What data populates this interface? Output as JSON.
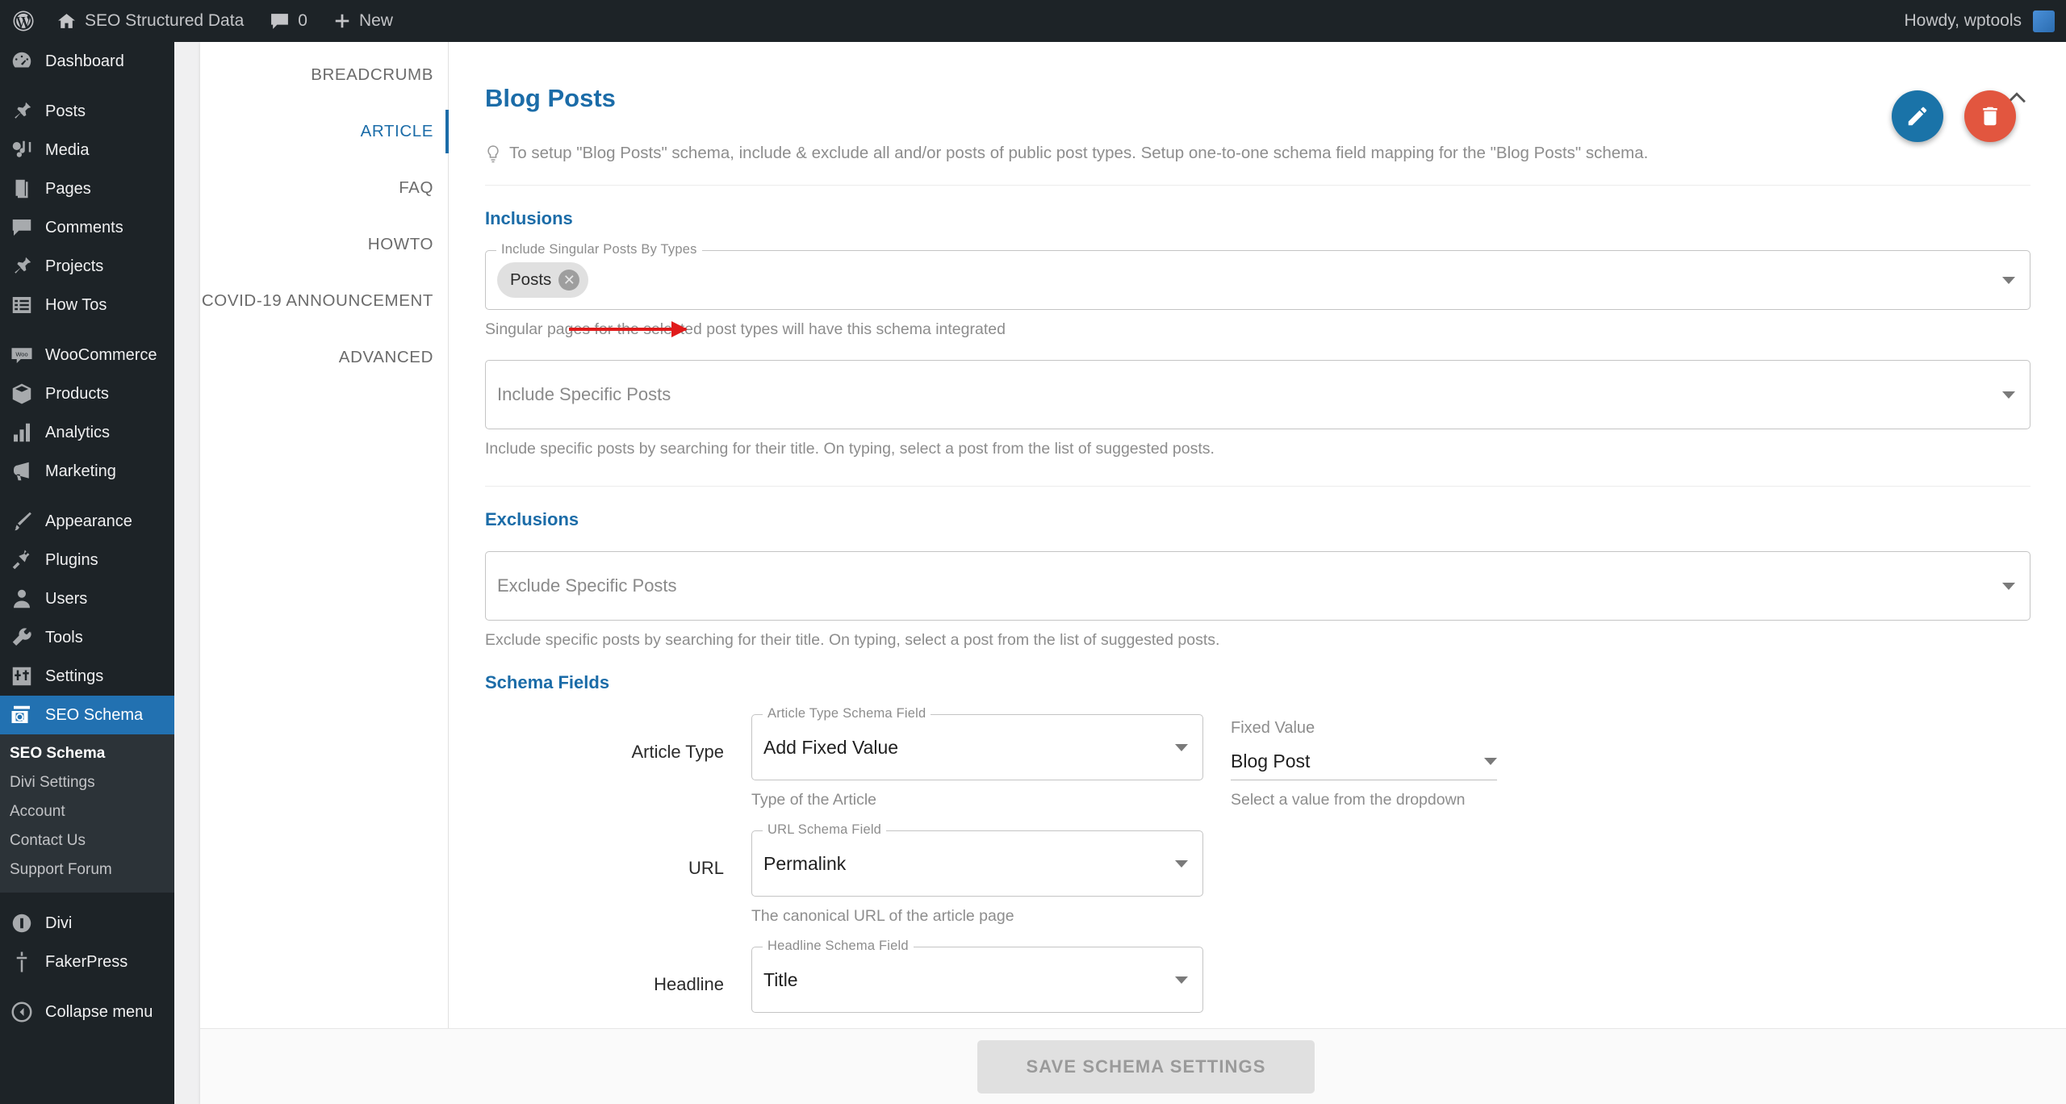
{
  "adminbar": {
    "site_title": "SEO Structured Data",
    "comment_count": "0",
    "new_label": "New",
    "howdy": "Howdy, wptools"
  },
  "sidebar": {
    "items": [
      {
        "label": "Dashboard",
        "icon": "dashboard-icon"
      },
      {
        "label": "Posts",
        "icon": "pin-icon"
      },
      {
        "label": "Media",
        "icon": "media-icon"
      },
      {
        "label": "Pages",
        "icon": "pages-icon"
      },
      {
        "label": "Comments",
        "icon": "comment-icon"
      },
      {
        "label": "Projects",
        "icon": "pin-icon"
      },
      {
        "label": "How Tos",
        "icon": "list-icon"
      },
      {
        "label": "WooCommerce",
        "icon": "woo-icon"
      },
      {
        "label": "Products",
        "icon": "box-icon"
      },
      {
        "label": "Analytics",
        "icon": "bars-icon"
      },
      {
        "label": "Marketing",
        "icon": "megaphone-icon"
      },
      {
        "label": "Appearance",
        "icon": "brush-icon"
      },
      {
        "label": "Plugins",
        "icon": "plug-icon"
      },
      {
        "label": "Users",
        "icon": "user-icon"
      },
      {
        "label": "Tools",
        "icon": "wrench-icon"
      },
      {
        "label": "Settings",
        "icon": "sliders-icon"
      },
      {
        "label": "SEO Schema",
        "icon": "schema-icon"
      },
      {
        "label": "Divi",
        "icon": "divi-icon"
      },
      {
        "label": "FakerPress",
        "icon": "faker-icon"
      },
      {
        "label": "Collapse menu",
        "icon": "collapse-icon"
      }
    ],
    "submenu": [
      "SEO Schema",
      "Divi Settings",
      "Account",
      "Contact Us",
      "Support Forum"
    ]
  },
  "tabs": [
    "BREADCRUMB",
    "ARTICLE",
    "FAQ",
    "HOWTO",
    "COVID-19 ANNOUNCEMENT",
    "ADVANCED"
  ],
  "active_tab": "ARTICLE",
  "card": {
    "title": "Blog Posts",
    "description": "To setup \"Blog Posts\" schema, include & exclude all and/or posts of public post types. Setup one-to-one schema field mapping for the \"Blog Posts\" schema."
  },
  "inclusions": {
    "heading": "Inclusions",
    "post_types_legend": "Include Singular Posts By Types",
    "post_types_chip": "Posts",
    "post_types_helper": "Singular pages for the selected post types will have this schema integrated",
    "specific_placeholder": "Include Specific Posts",
    "specific_helper": "Include specific posts by searching for their title. On typing, select a post from the list of suggested posts."
  },
  "exclusions": {
    "heading": "Exclusions",
    "specific_placeholder": "Exclude Specific Posts",
    "specific_helper": "Exclude specific posts by searching for their title. On typing, select a post from the list of suggested posts."
  },
  "schema_fields": {
    "heading": "Schema Fields",
    "rows": [
      {
        "label": "Article Type",
        "legend": "Article Type Schema Field",
        "value": "Add Fixed Value",
        "helper": "Type of the Article",
        "side_label": "Fixed Value",
        "side_value": "Blog Post",
        "side_helper": "Select a value from the dropdown"
      },
      {
        "label": "URL",
        "legend": "URL Schema Field",
        "value": "Permalink",
        "helper": "The canonical URL of the article page"
      },
      {
        "label": "Headline",
        "legend": "Headline Schema Field",
        "value": "Title",
        "helper": ""
      }
    ]
  },
  "footer": {
    "save_label": "Save Schema Settings"
  },
  "colors": {
    "accent": "#1b6ca8",
    "wp_blue": "#2271b1",
    "fab_edit": "#1a73a8",
    "fab_delete": "#e2563f",
    "annotation": "#e01b1b"
  }
}
